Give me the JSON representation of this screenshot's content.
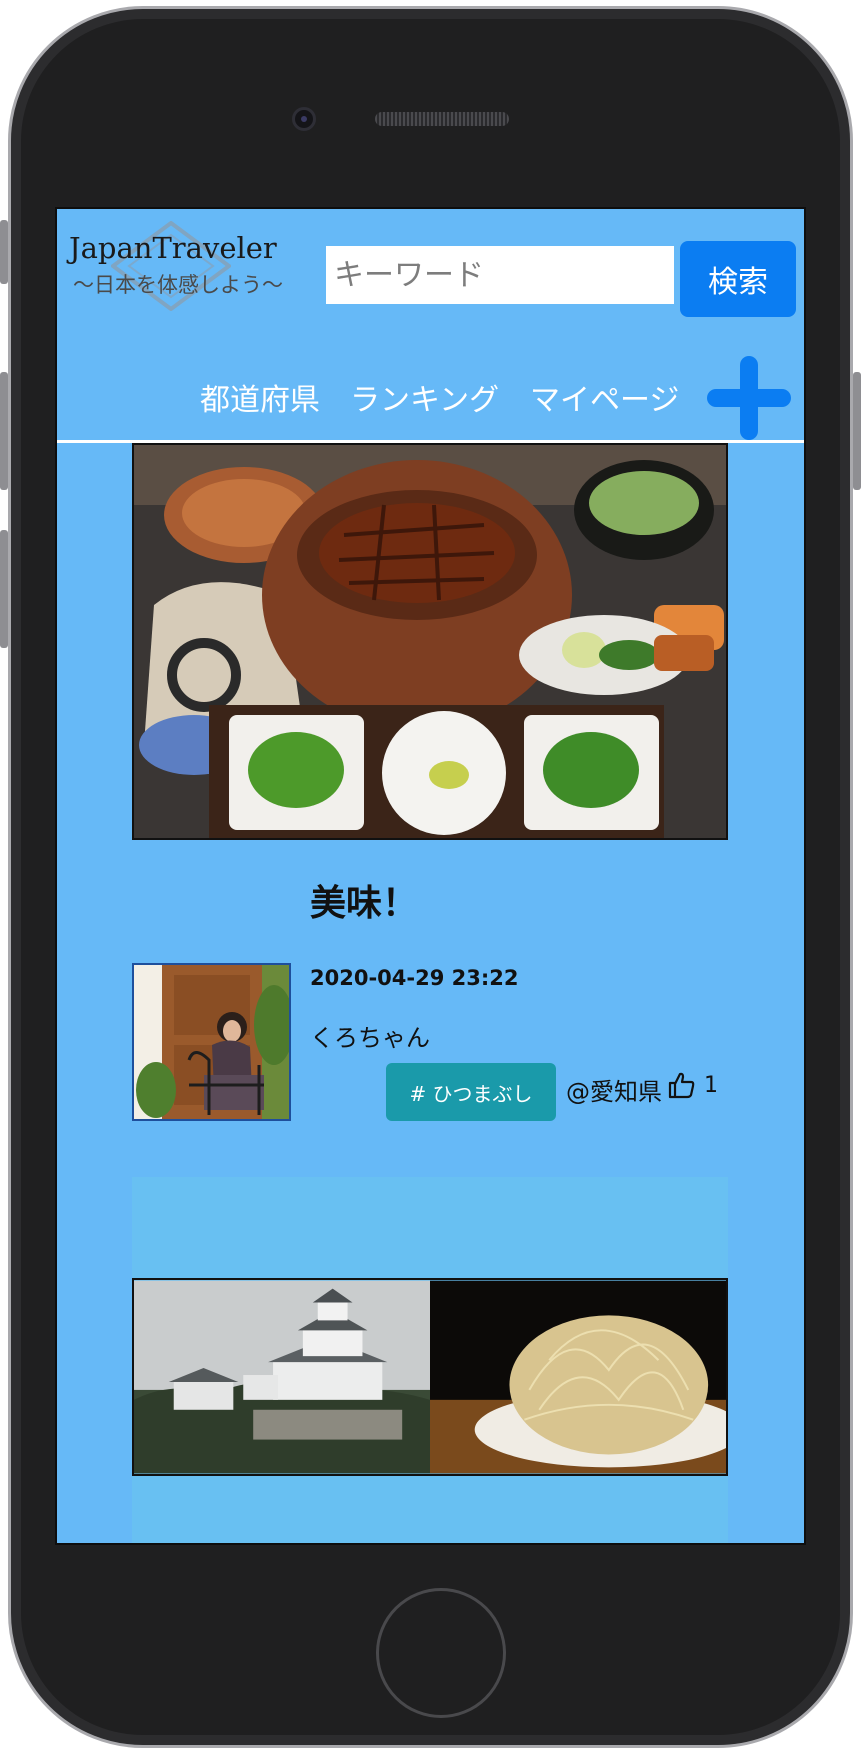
{
  "header": {
    "logo_title": "JapanTraveler",
    "logo_subtitle": "〜日本を体感しよう〜",
    "search_placeholder": "キーワード",
    "search_button": "検索"
  },
  "nav": {
    "items": [
      "都道府県",
      "ランキング",
      "マイページ"
    ],
    "add_icon": "plus-icon"
  },
  "post": {
    "title": "美味！",
    "date": "2020-04-29 23:22",
    "user": "くろちゃん",
    "tag": "# ひつまぶし",
    "prefecture": "@愛知県",
    "like_count": "1"
  },
  "colors": {
    "screen_bg": "#66b9f7",
    "button_blue": "#0b7df2",
    "tag_teal": "#1a9aaa",
    "card_bg": "#68c0f2"
  }
}
